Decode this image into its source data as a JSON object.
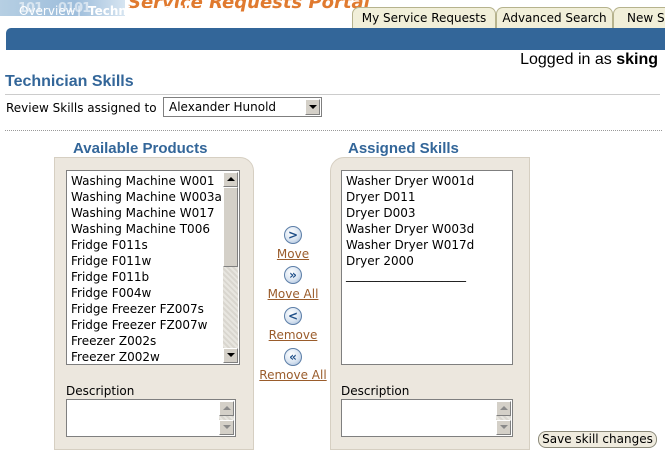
{
  "header": {
    "brand_title": "Service Requests Portal",
    "tabs": [
      {
        "label": "My Service Requests"
      },
      {
        "label": "Advanced Search"
      },
      {
        "label": "New S"
      }
    ],
    "nav": {
      "items": [
        {
          "label": "Overview"
        },
        {
          "label": "Technician Skills"
        }
      ],
      "separator": "|"
    },
    "logged_in_prefix": "Logged in as",
    "logged_in_user": "sking"
  },
  "page": {
    "title": "Technician Skills",
    "review_label": "Review Skills assigned to",
    "technician_selected": "Alexander Hunold"
  },
  "available": {
    "heading": "Available Products",
    "items": [
      "Washing Machine W001",
      "Washing Machine W003a",
      "Washing Machine W017",
      "Washing Machine T006",
      "Fridge F011s",
      "Fridge F011w",
      "Fridge F011b",
      "Fridge F004w",
      "Fridge Freezer FZ007s",
      "Fridge Freezer FZ007w",
      "Freezer Z002s",
      "Freezer Z002w"
    ],
    "description_label": "Description",
    "description_value": ""
  },
  "assigned": {
    "heading": "Assigned Skills",
    "items": [
      "Washer Dryer W001d",
      "Dryer D011",
      "Dryer D003",
      "Washer Dryer W003d",
      "Washer Dryer W017d",
      "Dryer 2000"
    ],
    "placeholder_line": "____________________",
    "description_label": "Description",
    "description_value": ""
  },
  "shuttle": {
    "move": {
      "icon": "move-right-icon",
      "glyph": ">",
      "label": "Move"
    },
    "move_all": {
      "icon": "move-all-right-icon",
      "glyph": "»",
      "label": "Move All"
    },
    "remove": {
      "icon": "remove-left-icon",
      "glyph": "<",
      "label": "Remove"
    },
    "remove_all": {
      "icon": "remove-all-left-icon",
      "glyph": "«",
      "label": "Remove All"
    }
  },
  "actions": {
    "save_label": "Save skill changes"
  },
  "colors": {
    "brand_blue": "#336699",
    "brand_orange": "#e07a2f",
    "panel_bg": "#ece7de",
    "link_brown": "#9a5c2b"
  }
}
